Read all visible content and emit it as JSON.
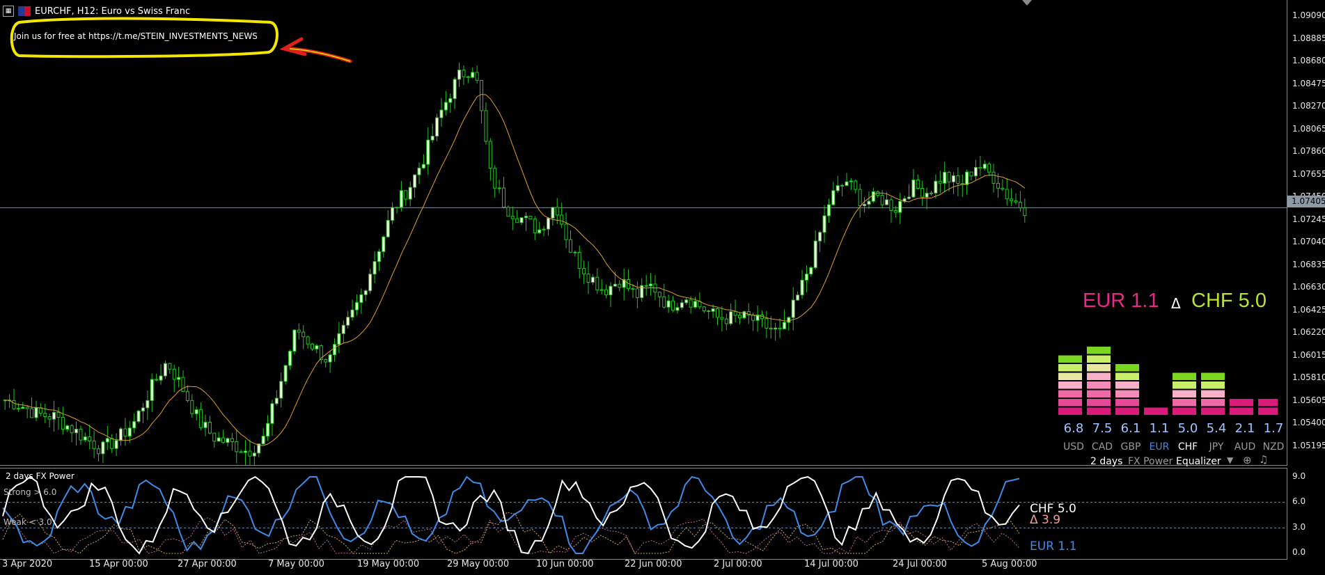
{
  "window": {
    "title": "EURCHF, H12:  Euro vs Swiss Franc",
    "symbol_icon": "grid-icon",
    "flag_icon": "eu-flag-icon"
  },
  "annotation": {
    "text": "Join us for free at https://t.me/STEIN_INVESTMENTS_NEWS",
    "highlight_color": "#f5e600",
    "arrow_color": "#e0201a"
  },
  "price_axis": {
    "labels": [
      "1.09090",
      "1.08885",
      "1.08680",
      "1.08475",
      "1.08270",
      "1.08065",
      "1.07860",
      "1.07655",
      "1.07450",
      "1.07245",
      "1.07040",
      "1.06835",
      "1.06630",
      "1.06425",
      "1.06220",
      "1.06015",
      "1.05810",
      "1.05605",
      "1.05400",
      "1.05195"
    ],
    "current_price": "1.07405"
  },
  "time_axis": {
    "labels": [
      "3 Apr 2020",
      "15 Apr 00:00",
      "27 Apr 00:00",
      "7 May 00:00",
      "19 May 00:00",
      "29 May 00:00",
      "10 Jun 00:00",
      "22 Jun 00:00",
      "2 Jul 00:00",
      "14 Jul 00:00",
      "24 Jul 00:00",
      "5 Aug 00:00"
    ]
  },
  "strength_panel": {
    "base": "EUR 1.1",
    "delta_symbol": "Δ",
    "quote": "CHF 5.0",
    "currencies": [
      {
        "name": "USD",
        "value": "6.8"
      },
      {
        "name": "CAD",
        "value": "7.5"
      },
      {
        "name": "GBP",
        "value": "6.1"
      },
      {
        "name": "EUR",
        "value": "1.1"
      },
      {
        "name": "CHF",
        "value": "5.0"
      },
      {
        "name": "JPY",
        "value": "5.4"
      },
      {
        "name": "AUD",
        "value": "2.1"
      },
      {
        "name": "NZD",
        "value": "1.7"
      }
    ],
    "period": "2 days",
    "indicator_name": "FX Power",
    "mode": "Equalizer",
    "base_color": "#e8288a",
    "quote_color": "#b6e62c"
  },
  "indicator": {
    "title": "2 days FX Power",
    "strong_label": "Strong > 6.0",
    "weak_label": "Weak < 3.0",
    "axis_labels": [
      "9.0",
      "6.0",
      "3.0",
      "0.0"
    ],
    "quote_label": "CHF 5.0",
    "delta_label": "Δ 3.9",
    "base_label": "EUR 1.1"
  },
  "chart_data": {
    "type": "candlestick",
    "symbol": "EURCHF",
    "timeframe": "H12",
    "ylim": [
      1.0512,
      1.0925
    ],
    "current_price": 1.07405,
    "approx_close_path": [
      1.0565,
      1.056,
      1.0552,
      1.055,
      1.054,
      1.053,
      1.052,
      1.053,
      1.0545,
      1.0575,
      1.06,
      1.0575,
      1.0545,
      1.053,
      1.0525,
      1.0518,
      1.053,
      1.058,
      1.063,
      1.0615,
      1.06,
      1.063,
      1.066,
      1.07,
      1.074,
      1.076,
      1.079,
      1.083,
      1.086,
      1.087,
      1.077,
      1.074,
      1.073,
      1.072,
      1.0745,
      1.07,
      1.068,
      1.0665,
      1.0675,
      1.066,
      1.067,
      1.065,
      1.066,
      1.065,
      1.064,
      1.064,
      1.064,
      1.0632,
      1.0625,
      1.066,
      1.07,
      1.075,
      1.0765,
      1.0745,
      1.075,
      1.074,
      1.076,
      1.0755,
      1.077,
      1.076,
      1.078,
      1.077,
      1.075,
      1.074
    ],
    "indicator": {
      "name": "2 days FX Power",
      "ylim": [
        0,
        9
      ],
      "levels": [
        6.0,
        3.0
      ],
      "series": [
        {
          "name": "CHF",
          "last": 5.0
        },
        {
          "name": "EUR",
          "last": 1.1
        }
      ]
    }
  }
}
